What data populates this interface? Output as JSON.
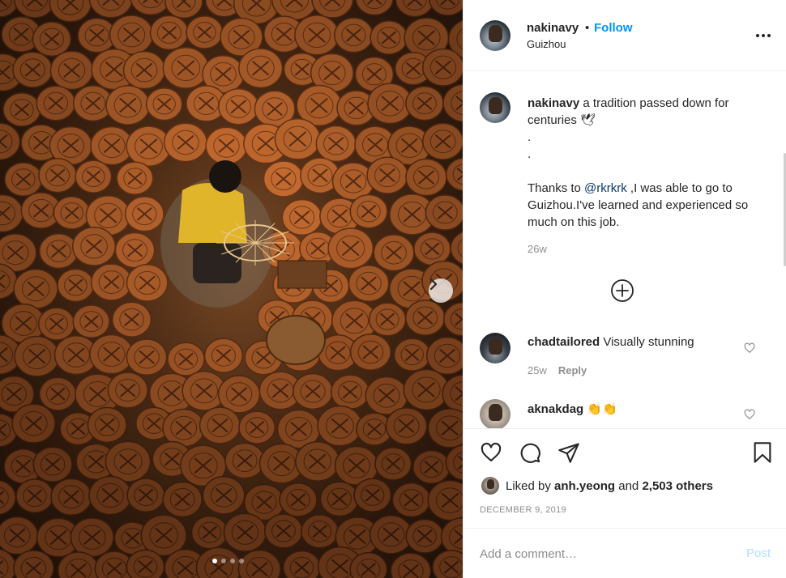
{
  "post": {
    "username": "nakinavy",
    "bullet": "•",
    "follow_label": "Follow",
    "location": "Guizhou",
    "more_icon": "more-horizontal-icon"
  },
  "caption": {
    "username": "nakinavy",
    "line1": "a tradition passed down for centuries 🕊",
    "dot1": ".",
    "dot2": ".",
    "thanks_pre": "Thanks to ",
    "mention": "@rkrkrk",
    "thanks_post": " ,I was able to go to Guizhou.I've learned and experienced so much on this job.",
    "time": "26w"
  },
  "comments": [
    {
      "username": "chadtailored",
      "text": "Visually stunning",
      "time": "25w",
      "reply_label": "Reply"
    },
    {
      "username": "aknakdag",
      "text": "👏👏"
    }
  ],
  "actions": {
    "like_icon": "heart-icon",
    "comment_icon": "comment-icon",
    "share_icon": "send-icon",
    "save_icon": "bookmark-icon"
  },
  "likes": {
    "prefix": "Liked by ",
    "user": "anh.yeong",
    "middle": " and ",
    "others": "2,503 others"
  },
  "date": "DECEMBER 9, 2019",
  "add_comment": {
    "placeholder": "Add a comment…",
    "post_label": "Post"
  },
  "carousel": {
    "slide_count": 4,
    "active_index": 0
  },
  "colors": {
    "accent": "#0095f6",
    "mention": "#00376b",
    "muted": "#8e8e8e",
    "post_disabled": "#b2dffc"
  }
}
